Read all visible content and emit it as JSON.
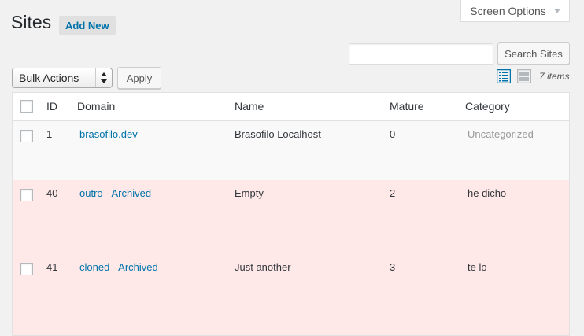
{
  "header": {
    "screen_options_label": "Screen Options",
    "title": "Sites",
    "add_new_label": "Add New"
  },
  "search": {
    "value": "",
    "button_label": "Search Sites"
  },
  "toolbar": {
    "bulk_actions_selected": "Bulk Actions",
    "apply_label": "Apply",
    "items_count": "7 items"
  },
  "table": {
    "columns": [
      "ID",
      "Domain",
      "Name",
      "Mature",
      "Category"
    ],
    "rows": [
      {
        "id": "1",
        "domain": "brasofilo.dev",
        "name": "Brasofilo Localhost",
        "mature": "0",
        "category": "Uncategorized",
        "archived": false
      },
      {
        "id": "40",
        "domain": "outro - Archived",
        "name": "Empty",
        "mature": "2",
        "category": "he dicho",
        "archived": true
      },
      {
        "id": "41",
        "domain": "cloned - Archived",
        "name": "Just another",
        "mature": "3",
        "category": "te lo",
        "archived": true
      }
    ]
  },
  "colors": {
    "link": "#0073aa",
    "archived_row_bg": "#fee8e8",
    "alt_row_bg": "#f9f9f9",
    "page_bg": "#f1f1f1"
  }
}
